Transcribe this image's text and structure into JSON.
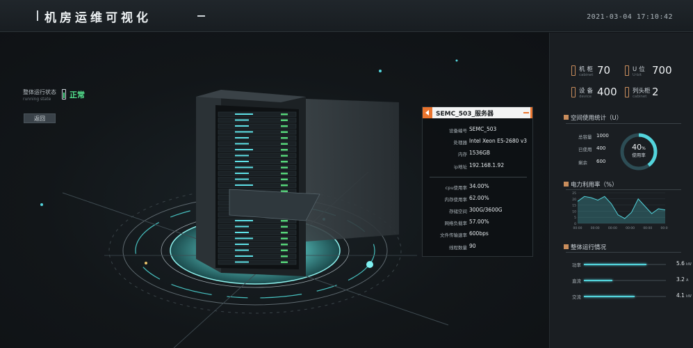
{
  "header": {
    "title": "机房运维可视化",
    "datetime": "2021-03-04 17:10:42"
  },
  "status": {
    "label": "整体运行状态",
    "sublabel": "running state",
    "value": "正常"
  },
  "back_button": "返回",
  "popup": {
    "title": "SEMC_503_服务器",
    "rows_top": [
      {
        "key": "设备编号",
        "value": "SEMC_503"
      },
      {
        "key": "处理器",
        "value": "Intel Xeon E5-2680 v3"
      },
      {
        "key": "内存",
        "value": "1536GB"
      },
      {
        "key": "ip地址",
        "value": "192.168.1.92"
      }
    ],
    "rows_bottom": [
      {
        "key": "cpu使用率",
        "value": "34.00%"
      },
      {
        "key": "内存使用率",
        "value": "62.00%"
      },
      {
        "key": "存储空间",
        "value": "300G/3600G"
      },
      {
        "key": "网络负载率",
        "value": "57.00%"
      },
      {
        "key": "文件传输速率",
        "value": "600bps"
      },
      {
        "key": "线程数量",
        "value": "90"
      }
    ]
  },
  "panel": {
    "stats": [
      {
        "name": "机柜",
        "en": "cabinet",
        "value": "70"
      },
      {
        "name": "U位",
        "en": "U-bit",
        "value": "700"
      },
      {
        "name": "设备",
        "en": "device",
        "value": "400"
      },
      {
        "name": "列头柜",
        "en": "cabinet",
        "value": "2"
      }
    ],
    "space": {
      "title": "空间使用统计（U）",
      "rows": [
        {
          "key": "总容量",
          "value": "1000"
        },
        {
          "key": "已使用",
          "value": "400"
        },
        {
          "key": "剩余",
          "value": "600"
        }
      ],
      "ring_percent": "40",
      "ring_unit": "%",
      "ring_label": "使用率"
    },
    "power": {
      "title": "电力利用率（%）"
    },
    "operation": {
      "title": "整体运行情况",
      "rows": [
        {
          "key": "功率",
          "value": "5.6",
          "unit": "kW",
          "fill": 0.76
        },
        {
          "key": "直流",
          "value": "3.2",
          "unit": "A",
          "fill": 0.35
        },
        {
          "key": "交流",
          "value": "4.1",
          "unit": "kW",
          "fill": 0.62
        }
      ]
    }
  },
  "chart_data": {
    "type": "area",
    "title": "电力利用率（%）",
    "x": [
      "00:00",
      "00:00",
      "00:00",
      "00:00",
      "00:00",
      "00:00"
    ],
    "yticks": [
      0,
      5,
      10,
      15,
      20,
      25
    ],
    "ylim": [
      0,
      25
    ],
    "series": [
      {
        "values": [
          18,
          22,
          21,
          19,
          22,
          16,
          7,
          4,
          9,
          20,
          14,
          8,
          12,
          11
        ]
      }
    ],
    "grid": true,
    "legend": "none"
  },
  "colors": {
    "accent_orange": "#e9742e",
    "accent_teal": "#53d4dc",
    "status_green": "#54e38e"
  }
}
